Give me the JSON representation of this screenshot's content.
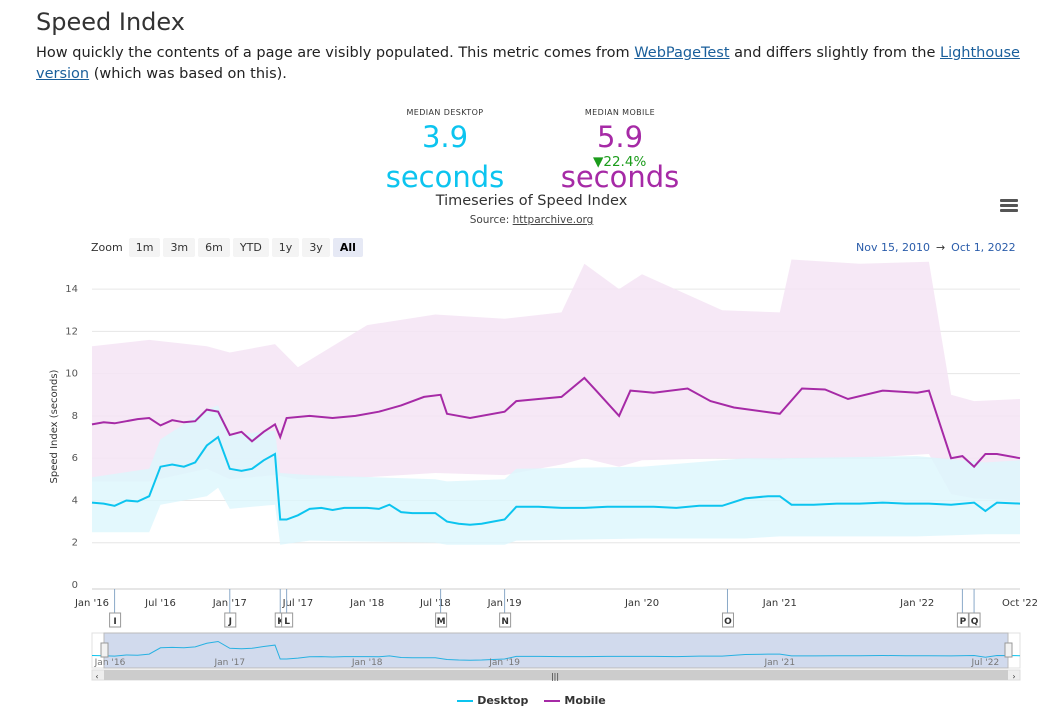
{
  "page": {
    "title": "Speed Index",
    "desc_1": "How quickly the contents of a page are visibly populated. This metric comes from ",
    "link_wpt": "WebPageTest",
    "desc_2": " and differs slightly from the ",
    "link_lh": "Lighthouse version",
    "desc_3": " (which was based on this)."
  },
  "medians": {
    "desktop_label": "MEDIAN DESKTOP",
    "desktop_value": "3.9 seconds",
    "mobile_label": "MEDIAN MOBILE",
    "mobile_value": "5.9 seconds",
    "mobile_change": "▼22.4%",
    "colors": {
      "desktop": "#0cc4ef",
      "mobile": "#a62aa6",
      "change": "#1b9c1b"
    }
  },
  "toolbar": {
    "zoom_label": "Zoom",
    "zoom_buttons": [
      "1m",
      "3m",
      "6m",
      "YTD",
      "1y",
      "3y",
      "All"
    ],
    "active_zoom": "All",
    "range_from": "Nov 15, 2010",
    "range_arrow": "→",
    "range_to": "Oct 1, 2022",
    "menu_icon": "hamburger-menu-icon"
  },
  "chart_data": {
    "type": "line",
    "title": "Timeseries of Speed Index",
    "source_label": "Source: ",
    "source_link": "httparchive.org",
    "ylabel": "Speed Index (seconds)",
    "xlabel": "",
    "ylim": [
      0,
      15
    ],
    "y_ticks": [
      0,
      2,
      4,
      6,
      8,
      10,
      12,
      14
    ],
    "x_range": [
      "2016-01-01",
      "2022-10-01"
    ],
    "x_tick_labels": [
      "Jan '16",
      "Jul '16",
      "Jan '17",
      "Jul '17",
      "Jan '18",
      "Jul '18",
      "Jan '19",
      "Jan '20",
      "Jan '21",
      "Jan '22",
      "Oct '22"
    ],
    "x_tick_dates": [
      "2016-01-01",
      "2016-07-01",
      "2017-01-01",
      "2017-07-01",
      "2018-01-01",
      "2018-07-01",
      "2019-01-01",
      "2020-01-01",
      "2021-01-01",
      "2022-01-01",
      "2022-10-01"
    ],
    "navigator_labels": [
      "Jan '16",
      "Jan '17",
      "Jan '18",
      "Jan '19",
      "Jan '21",
      "Jul '22"
    ],
    "navigator_label_dates": [
      "2016-01-01",
      "2017-01-01",
      "2018-01-01",
      "2019-01-01",
      "2021-01-01",
      "2022-07-01"
    ],
    "grid": true,
    "legend_position": "bottom-center",
    "flags": [
      {
        "label": "I",
        "date": "2016-03-01"
      },
      {
        "label": "J",
        "date": "2017-01-01"
      },
      {
        "label": "K",
        "date": "2017-05-15"
      },
      {
        "label": "L",
        "date": "2017-06-01"
      },
      {
        "label": "M",
        "date": "2018-07-15"
      },
      {
        "label": "N",
        "date": "2019-01-01"
      },
      {
        "label": "O",
        "date": "2020-08-15"
      },
      {
        "label": "P",
        "date": "2022-05-01"
      },
      {
        "label": "Q",
        "date": "2022-06-01"
      }
    ],
    "series": [
      {
        "name": "Desktop",
        "color": "#0cc4ef",
        "band_color": "#dcf6fc",
        "points": [
          [
            "2016-01-01",
            3.9
          ],
          [
            "2016-02-01",
            3.85
          ],
          [
            "2016-03-01",
            3.75
          ],
          [
            "2016-04-01",
            4.0
          ],
          [
            "2016-05-01",
            3.95
          ],
          [
            "2016-06-01",
            4.2
          ],
          [
            "2016-07-01",
            5.6
          ],
          [
            "2016-08-01",
            5.7
          ],
          [
            "2016-09-01",
            5.6
          ],
          [
            "2016-10-01",
            5.8
          ],
          [
            "2016-11-01",
            6.6
          ],
          [
            "2016-12-01",
            7.0
          ],
          [
            "2017-01-01",
            5.5
          ],
          [
            "2017-02-01",
            5.4
          ],
          [
            "2017-03-01",
            5.5
          ],
          [
            "2017-04-01",
            5.9
          ],
          [
            "2017-05-01",
            6.2
          ],
          [
            "2017-05-15",
            3.1
          ],
          [
            "2017-06-01",
            3.1
          ],
          [
            "2017-07-01",
            3.3
          ],
          [
            "2017-08-01",
            3.6
          ],
          [
            "2017-09-01",
            3.65
          ],
          [
            "2017-10-01",
            3.55
          ],
          [
            "2017-11-01",
            3.65
          ],
          [
            "2017-12-01",
            3.65
          ],
          [
            "2018-01-01",
            3.65
          ],
          [
            "2018-02-01",
            3.6
          ],
          [
            "2018-03-01",
            3.8
          ],
          [
            "2018-04-01",
            3.45
          ],
          [
            "2018-05-01",
            3.4
          ],
          [
            "2018-06-01",
            3.4
          ],
          [
            "2018-07-01",
            3.4
          ],
          [
            "2018-08-01",
            3.0
          ],
          [
            "2018-09-01",
            2.9
          ],
          [
            "2018-10-01",
            2.85
          ],
          [
            "2018-11-01",
            2.9
          ],
          [
            "2018-12-01",
            3.0
          ],
          [
            "2019-01-01",
            3.1
          ],
          [
            "2019-02-01",
            3.7
          ],
          [
            "2019-04-01",
            3.7
          ],
          [
            "2019-06-01",
            3.65
          ],
          [
            "2019-08-01",
            3.65
          ],
          [
            "2019-10-01",
            3.7
          ],
          [
            "2019-12-01",
            3.7
          ],
          [
            "2020-02-01",
            3.7
          ],
          [
            "2020-04-01",
            3.65
          ],
          [
            "2020-06-01",
            3.75
          ],
          [
            "2020-08-01",
            3.75
          ],
          [
            "2020-10-01",
            4.1
          ],
          [
            "2020-12-01",
            4.2
          ],
          [
            "2021-01-01",
            4.2
          ],
          [
            "2021-02-01",
            3.8
          ],
          [
            "2021-04-01",
            3.8
          ],
          [
            "2021-06-01",
            3.85
          ],
          [
            "2021-08-01",
            3.85
          ],
          [
            "2021-10-01",
            3.9
          ],
          [
            "2021-12-01",
            3.85
          ],
          [
            "2022-02-01",
            3.85
          ],
          [
            "2022-04-01",
            3.8
          ],
          [
            "2022-06-01",
            3.9
          ],
          [
            "2022-07-01",
            3.5
          ],
          [
            "2022-08-01",
            3.9
          ],
          [
            "2022-10-01",
            3.85
          ]
        ],
        "band": [
          [
            "2016-01-01",
            2.5,
            5.1
          ],
          [
            "2016-06-01",
            2.5,
            5.5
          ],
          [
            "2016-07-01",
            3.8,
            6.9
          ],
          [
            "2016-11-01",
            4.2,
            8.3
          ],
          [
            "2016-12-01",
            4.6,
            8.5
          ],
          [
            "2017-01-01",
            3.6,
            7.1
          ],
          [
            "2017-05-01",
            3.8,
            7.3
          ],
          [
            "2017-05-15",
            1.9,
            5.3
          ],
          [
            "2017-08-01",
            2.1,
            5.2
          ],
          [
            "2018-07-01",
            2.0,
            5.0
          ],
          [
            "2018-08-01",
            1.9,
            4.9
          ],
          [
            "2019-01-01",
            1.9,
            5.0
          ],
          [
            "2019-02-01",
            2.1,
            5.5
          ],
          [
            "2020-01-01",
            2.2,
            5.6
          ],
          [
            "2020-10-01",
            2.2,
            6.0
          ],
          [
            "2021-01-01",
            2.3,
            6.0
          ],
          [
            "2022-01-01",
            2.3,
            6.1
          ],
          [
            "2022-07-01",
            2.4,
            5.8
          ],
          [
            "2022-10-01",
            2.4,
            5.9
          ]
        ]
      },
      {
        "name": "Mobile",
        "color": "#a62aa6",
        "band_color": "#f4e4f4",
        "points": [
          [
            "2016-01-01",
            7.6
          ],
          [
            "2016-02-01",
            7.7
          ],
          [
            "2016-03-01",
            7.65
          ],
          [
            "2016-04-01",
            7.75
          ],
          [
            "2016-05-01",
            7.85
          ],
          [
            "2016-06-01",
            7.9
          ],
          [
            "2016-07-01",
            7.55
          ],
          [
            "2016-08-01",
            7.8
          ],
          [
            "2016-09-01",
            7.7
          ],
          [
            "2016-10-01",
            7.75
          ],
          [
            "2016-11-01",
            8.3
          ],
          [
            "2016-12-01",
            8.2
          ],
          [
            "2017-01-01",
            7.1
          ],
          [
            "2017-02-01",
            7.25
          ],
          [
            "2017-03-01",
            6.8
          ],
          [
            "2017-04-01",
            7.25
          ],
          [
            "2017-05-01",
            7.6
          ],
          [
            "2017-05-15",
            7.0
          ],
          [
            "2017-06-01",
            7.9
          ],
          [
            "2017-08-01",
            8.0
          ],
          [
            "2017-10-01",
            7.9
          ],
          [
            "2017-12-01",
            8.0
          ],
          [
            "2018-02-01",
            8.2
          ],
          [
            "2018-04-01",
            8.5
          ],
          [
            "2018-06-01",
            8.9
          ],
          [
            "2018-07-15",
            9.0
          ],
          [
            "2018-08-01",
            8.1
          ],
          [
            "2018-10-01",
            7.9
          ],
          [
            "2019-01-01",
            8.2
          ],
          [
            "2019-02-01",
            8.7
          ],
          [
            "2019-04-01",
            8.8
          ],
          [
            "2019-06-01",
            8.9
          ],
          [
            "2019-08-01",
            9.8
          ],
          [
            "2019-09-01",
            9.2
          ],
          [
            "2019-11-01",
            8.0
          ],
          [
            "2019-12-01",
            9.2
          ],
          [
            "2020-02-01",
            9.1
          ],
          [
            "2020-05-01",
            9.3
          ],
          [
            "2020-07-01",
            8.7
          ],
          [
            "2020-09-01",
            8.4
          ],
          [
            "2021-01-01",
            8.1
          ],
          [
            "2021-03-01",
            9.3
          ],
          [
            "2021-05-01",
            9.25
          ],
          [
            "2021-07-01",
            8.8
          ],
          [
            "2021-10-01",
            9.2
          ],
          [
            "2022-01-01",
            9.1
          ],
          [
            "2022-02-01",
            9.2
          ],
          [
            "2022-04-01",
            6.0
          ],
          [
            "2022-05-01",
            6.1
          ],
          [
            "2022-06-01",
            5.6
          ],
          [
            "2022-07-01",
            6.2
          ],
          [
            "2022-08-01",
            6.2
          ],
          [
            "2022-10-01",
            6.0
          ]
        ],
        "band": [
          [
            "2016-01-01",
            4.9,
            11.3
          ],
          [
            "2016-06-01",
            4.9,
            11.6
          ],
          [
            "2016-11-01",
            5.5,
            11.3
          ],
          [
            "2017-01-01",
            5.0,
            11.0
          ],
          [
            "2017-05-01",
            5.2,
            11.4
          ],
          [
            "2017-07-01",
            5.0,
            10.3
          ],
          [
            "2018-01-01",
            5.1,
            12.3
          ],
          [
            "2018-07-01",
            5.3,
            12.8
          ],
          [
            "2019-01-01",
            5.2,
            12.6
          ],
          [
            "2019-06-01",
            5.7,
            12.9
          ],
          [
            "2019-08-01",
            6.0,
            15.2
          ],
          [
            "2019-11-01",
            5.6,
            14.0
          ],
          [
            "2020-01-01",
            5.9,
            14.7
          ],
          [
            "2020-08-01",
            6.0,
            13.0
          ],
          [
            "2021-01-01",
            5.9,
            12.9
          ],
          [
            "2021-02-01",
            6.0,
            15.4
          ],
          [
            "2021-08-01",
            6.0,
            15.2
          ],
          [
            "2022-02-01",
            6.2,
            15.3
          ],
          [
            "2022-04-01",
            4.3,
            9.0
          ],
          [
            "2022-06-01",
            4.1,
            8.7
          ],
          [
            "2022-10-01",
            4.0,
            8.8
          ]
        ]
      }
    ]
  }
}
